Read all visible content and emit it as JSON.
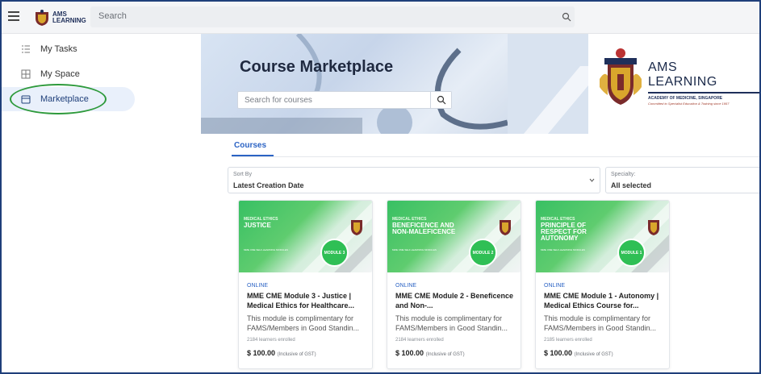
{
  "topbar": {
    "brand_line1": "AMS",
    "brand_line2": "LEARNING",
    "search_label": "Search",
    "icons": {
      "menu": "hamburger-menu-icon",
      "search": "search-icon"
    }
  },
  "sidebar": {
    "items": [
      {
        "label": "My Tasks",
        "icon": "task-list-icon"
      },
      {
        "label": "My Space",
        "icon": "grid-icon"
      },
      {
        "label": "Marketplace",
        "icon": "store-icon",
        "active": true
      }
    ]
  },
  "banner": {
    "title": "Course Marketplace",
    "search_placeholder": "Search for courses",
    "logo_line1": "AMS",
    "logo_line2": "LEARNING",
    "logo_sub": "ACADEMY OF MEDICINE, SINGAPORE",
    "logo_tagline": "Committed to Specialist Education & Training since 1957"
  },
  "tabs": [
    {
      "label": "Courses",
      "active": true
    }
  ],
  "filters": {
    "sort": {
      "label": "Sort By",
      "value": "Latest Creation Date"
    },
    "specialty": {
      "label": "Specialty:",
      "value": "All selected"
    }
  },
  "cards": [
    {
      "image_category": "MEDICAL ETHICS",
      "image_title": "JUSTICE",
      "image_subtitle": "MME CME SELF-LEARNING MODULES",
      "badge": "MODULE 3",
      "type": "ONLINE",
      "title": "MME CME Module 3 - Justice | Medical Ethics for Healthcare...",
      "description": "This module is complimentary for FAMS/Members in Good Standin...",
      "enrolled": "2184 learners enrolled",
      "price": "$ 100.00",
      "price_note": "(Inclusive of GST)"
    },
    {
      "image_category": "MEDICAL ETHICS",
      "image_title": "BENEFICENCE AND NON-MALEFICENCE",
      "image_subtitle": "MME CME SELF-LEARNING MODULES",
      "badge": "MODULE 2",
      "type": "ONLINE",
      "title": "MME CME Module 2 - Beneficence and Non-...",
      "description": "This module is complimentary for FAMS/Members in Good Standin...",
      "enrolled": "2184 learners enrolled",
      "price": "$ 100.00",
      "price_note": "(Inclusive of GST)"
    },
    {
      "image_category": "MEDICAL ETHICS",
      "image_title": "PRINCIPLE OF RESPECT FOR AUTONOMY",
      "image_subtitle": "MME CME SELF-LEARNING MODULES",
      "badge": "MODULE 1",
      "type": "ONLINE",
      "title": "MME CME Module 1 - Autonomy | Medical Ethics Course for...",
      "description": "This module is complimentary for FAMS/Members in Good Standin...",
      "enrolled": "2185 learners enrolled",
      "price": "$ 100.00",
      "price_note": "(Inclusive of GST)"
    }
  ],
  "colors": {
    "accent": "#2b63c4",
    "brand_navy": "#1f2f5a",
    "highlight_green": "#2e9a3c",
    "card_green": "#38c063"
  }
}
